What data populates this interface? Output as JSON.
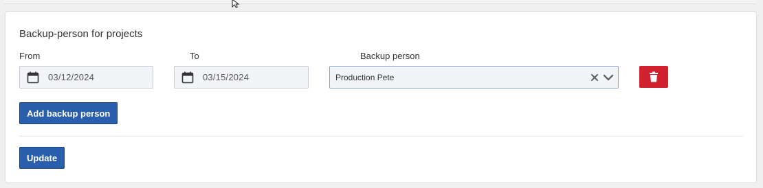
{
  "section": {
    "title": "Backup-person for projects"
  },
  "labels": {
    "from": "From",
    "to": "To",
    "backup_person": "Backup person"
  },
  "fields": {
    "from_date": "03/12/2024",
    "to_date": "03/15/2024",
    "backup_person_value": "Production Pete"
  },
  "buttons": {
    "add_backup_person": "Add backup person",
    "update": "Update"
  },
  "icons": {
    "from_calendar": "calendar-icon",
    "to_calendar": "calendar-icon",
    "clear": "clear-x-icon",
    "dropdown": "chevron-down-icon",
    "delete": "trash-icon",
    "cursor": "mouse-pointer-icon"
  },
  "colors": {
    "primary": "#2a5fad",
    "danger": "#d0212f",
    "field_bg": "#f2f4f7"
  }
}
